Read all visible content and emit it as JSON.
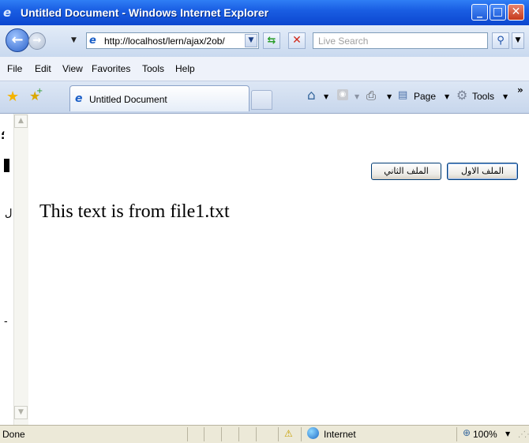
{
  "window": {
    "title": "Untitled Document - Windows Internet Explorer",
    "min_glyph": "_",
    "max_glyph": "□",
    "close_glyph": "✕"
  },
  "address": {
    "url": "http://localhost/lern/ajax/2ob/",
    "search_placeholder": "Live Search"
  },
  "menu": {
    "file": "File",
    "edit": "Edit",
    "view": "View",
    "favorites": "Favorites",
    "tools": "Tools",
    "help": "Help"
  },
  "tab": {
    "title": "Untitled Document"
  },
  "command_bar": {
    "page": "Page",
    "tools": "Tools"
  },
  "content": {
    "file1_button": "الملف الاول",
    "file2_button": "الملف الثاني",
    "text": "This text is from file1.txt"
  },
  "status": {
    "text": "Done",
    "zone": "Internet",
    "zoom": "100%"
  },
  "icons": {
    "back": "back-arrow-icon",
    "forward": "forward-arrow-icon",
    "page": "ie-page-icon",
    "refresh": "refresh-icon",
    "stop": "stop-icon",
    "search": "search-icon",
    "favorites": "favorites-star-icon",
    "add_favorite": "add-favorite-icon",
    "home": "home-icon",
    "feeds": "feeds-icon",
    "print": "print-icon",
    "tools": "gear-icon",
    "zone": "globe-icon",
    "zoom": "zoom-icon"
  }
}
